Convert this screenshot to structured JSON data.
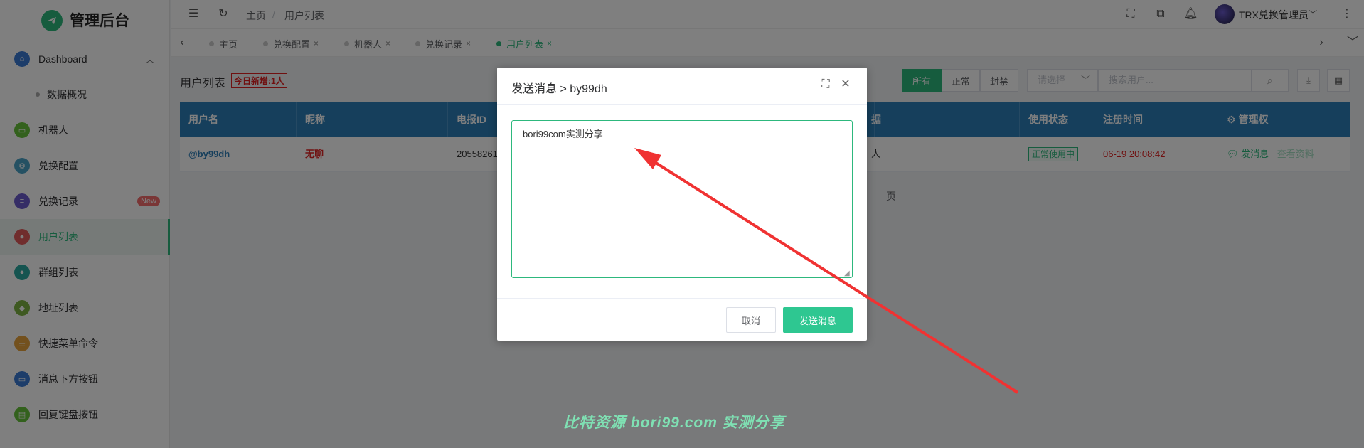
{
  "app": {
    "title": "管理后台"
  },
  "sidebar": {
    "items": [
      {
        "label": "Dashboard",
        "color": "#3a7bd5",
        "icon": "home-icon",
        "glyph": "⌂"
      },
      {
        "label": "数据概况",
        "sub": true
      },
      {
        "label": "机器人",
        "color": "#67c23a",
        "icon": "monitor-icon",
        "glyph": "▭"
      },
      {
        "label": "兑换配置",
        "color": "#4aa3c7",
        "icon": "settings-icon",
        "glyph": "⚙"
      },
      {
        "label": "兑换记录",
        "color": "#6a5acd",
        "icon": "document-icon",
        "glyph": "≡",
        "badge": "New"
      },
      {
        "label": "用户列表",
        "color": "#e05a5a",
        "icon": "user-icon",
        "glyph": "●",
        "active": true
      },
      {
        "label": "群组列表",
        "color": "#2aa9a0",
        "icon": "group-icon",
        "glyph": "●"
      },
      {
        "label": "地址列表",
        "color": "#7cb342",
        "icon": "location-icon",
        "glyph": "◆"
      },
      {
        "label": "快捷菜单命令",
        "color": "#e6a23c",
        "icon": "menu-icon",
        "glyph": "☰"
      },
      {
        "label": "消息下方按钮",
        "color": "#3a7bd5",
        "icon": "button-icon",
        "glyph": "▭"
      },
      {
        "label": "回复键盘按钮",
        "color": "#67c23a",
        "icon": "keyboard-icon",
        "glyph": "▤"
      }
    ]
  },
  "header": {
    "breadcrumb": [
      "主页",
      "/",
      "用户列表"
    ],
    "user": "TRX兑换管理员"
  },
  "tabs": [
    {
      "label": "主页",
      "active": false
    },
    {
      "label": "兑换配置",
      "active": false
    },
    {
      "label": "机器人",
      "active": false
    },
    {
      "label": "兑换记录",
      "active": false
    },
    {
      "label": "用户列表",
      "active": true
    }
  ],
  "main": {
    "title": "用户列表",
    "today_tag": "今日新增:1人",
    "filters": [
      "所有",
      "正常",
      "封禁"
    ],
    "select_placeholder": "请选择",
    "search_placeholder": "搜索用户...",
    "columns": [
      "用户名",
      "昵称",
      "电报ID",
      "",
      "据",
      "使用状态",
      "注册时间",
      "⚙ 管理权"
    ],
    "row": {
      "username": "@by99dh",
      "nickname": "无聊",
      "telegram_id": "20558261",
      "data": "人",
      "status": "正常使用中",
      "reg_time": "06-19 20:08:42",
      "action_msg": "发消息",
      "action_view": "查看资料"
    },
    "pager_suffix": "页"
  },
  "dialog": {
    "title": "发送消息 > by99dh",
    "message": "bori99com实测分享",
    "cancel": "取消",
    "send": "发送消息"
  },
  "watermark": "比特资源 bori99.com 实测分享",
  "colors": {
    "accent": "#2db87d",
    "table_header": "#2d7eb8",
    "arrow": "#f03232"
  }
}
